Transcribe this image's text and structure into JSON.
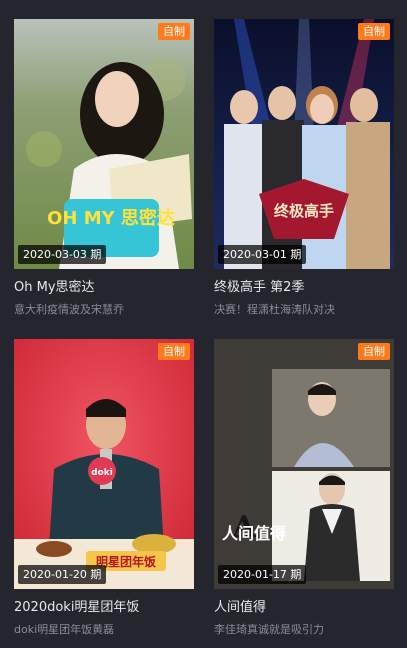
{
  "cards": [
    {
      "badge": "自制",
      "date": "2020-03-03 期",
      "title": "Oh My思密达",
      "subtitle": "意大利疫情波及宋慧乔",
      "thumb_logo": "OH MY 思密达"
    },
    {
      "badge": "自制",
      "date": "2020-03-01 期",
      "title": "终极高手 第2季",
      "subtitle": "决赛！程潇杜海涛队对决",
      "thumb_logo": "终极高手"
    },
    {
      "badge": "自制",
      "date": "2020-01-20 期",
      "title": "2020doki明星团年饭",
      "subtitle": "doki明星团年饭黄磊",
      "thumb_logo": "明星团年饭",
      "mic_text": "doki"
    },
    {
      "badge": "自制",
      "date": "2020-01-17 期",
      "title": "人间值得",
      "subtitle": "李佳琦真诚就是吸引力",
      "thumb_logo": "人间值得"
    }
  ],
  "colors": {
    "background": "#25262d",
    "badge": "#ff7a1a",
    "title_text": "#e8e8ea",
    "subtitle_text": "#8b8c93"
  }
}
